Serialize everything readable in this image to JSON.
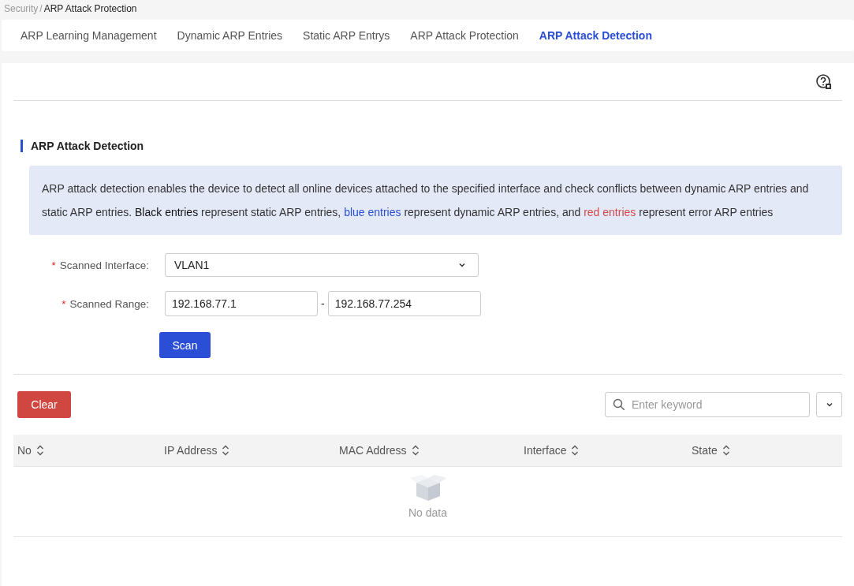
{
  "breadcrumb": {
    "separator": "/",
    "items": [
      {
        "label": "Security",
        "current": false
      },
      {
        "label": "ARP Attack Protection",
        "current": true
      }
    ]
  },
  "tabs": [
    {
      "label": "ARP Learning Management",
      "selected": false
    },
    {
      "label": "Dynamic ARP Entries",
      "selected": false
    },
    {
      "label": "Static ARP Entrys",
      "selected": false
    },
    {
      "label": "ARP Attack Protection",
      "selected": false
    },
    {
      "label": "ARP Attack Detection",
      "selected": true
    }
  ],
  "section": {
    "title": "ARP Attack Detection"
  },
  "description": [
    {
      "text": "ARP attack detection enables the device to detect all online devices attached to the specified interface and check conflicts between dynamic ARP entries and static ARP entries. ",
      "color": "#333333"
    },
    {
      "text": "Black entries",
      "color": "#111111"
    },
    {
      "text": " represent static ARP entries, ",
      "color": "#333333"
    },
    {
      "text": "blue entries",
      "color": "#2a4fd6"
    },
    {
      "text": " represent dynamic ARP entries, and ",
      "color": "#333333"
    },
    {
      "text": "red entries",
      "color": "#d04a4a"
    },
    {
      "text": " represent error ARP entries",
      "color": "#333333"
    }
  ],
  "form": {
    "interface": {
      "label": "Scanned Interface:",
      "required_mark": "*",
      "value": "VLAN1"
    },
    "range": {
      "label": "Scanned Range:",
      "required_mark": "*",
      "start": "192.168.77.1",
      "separator": "-",
      "end": "192.168.77.254"
    },
    "scan_button": "Scan"
  },
  "toolbar": {
    "clear_button": "Clear",
    "search": {
      "placeholder": "Enter keyword"
    }
  },
  "table": {
    "columns": [
      "No",
      "IP Address",
      "MAC Address",
      "Interface",
      "State"
    ],
    "empty_text": "No data"
  }
}
